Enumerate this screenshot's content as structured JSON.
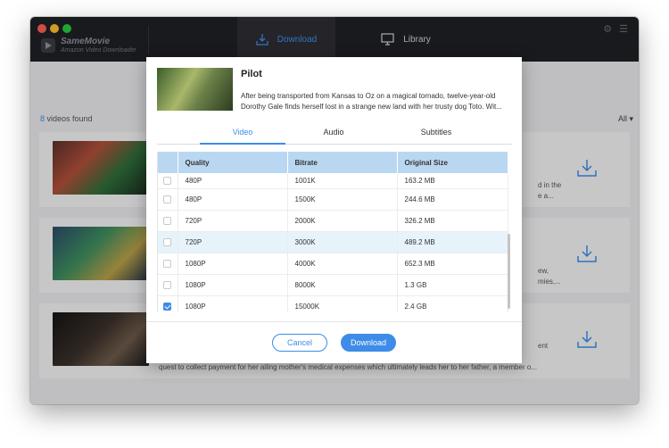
{
  "app": {
    "brand_name": "SameMovie",
    "brand_sub": "Amazon Video Downloader",
    "nav_download": "Download",
    "nav_library": "Library"
  },
  "main": {
    "count": "8",
    "count_label": " videos found",
    "filter": "All",
    "bg_texts": [
      "d in the",
      "e a...",
      "ew,",
      "mies,...",
      "ent",
      "quest to collect payment for her ailing mother's medical expenses which ultimately leads her to her father, a member o..."
    ]
  },
  "dialog": {
    "title": "Pilot",
    "description": "After being transported from Kansas to Oz on a magical tornado, twelve-year-old Dorothy Gale finds herself lost in a strange new land with her trusty dog Toto. Wit...",
    "tabs": [
      "Video",
      "Audio",
      "Subtitles"
    ],
    "columns": [
      "Quality",
      "Bitrate",
      "Original Size"
    ],
    "rows": [
      {
        "quality": "480P",
        "bitrate": "1001K",
        "size": "163.2 MB",
        "checked": false
      },
      {
        "quality": "480P",
        "bitrate": "1500K",
        "size": "244.6 MB",
        "checked": false
      },
      {
        "quality": "720P",
        "bitrate": "2000K",
        "size": "326.2 MB",
        "checked": false
      },
      {
        "quality": "720P",
        "bitrate": "3000K",
        "size": "489.2 MB",
        "checked": false
      },
      {
        "quality": "1080P",
        "bitrate": "4000K",
        "size": "652.3 MB",
        "checked": false
      },
      {
        "quality": "1080P",
        "bitrate": "8000K",
        "size": "1.3 GB",
        "checked": false
      },
      {
        "quality": "1080P",
        "bitrate": "15000K",
        "size": "2.4 GB",
        "checked": true
      }
    ],
    "cancel_label": "Cancel",
    "download_label": "Download"
  },
  "colors": {
    "accent": "#3d8ce8",
    "titlebar": "#1f2024",
    "header_row": "#bad7f1"
  }
}
